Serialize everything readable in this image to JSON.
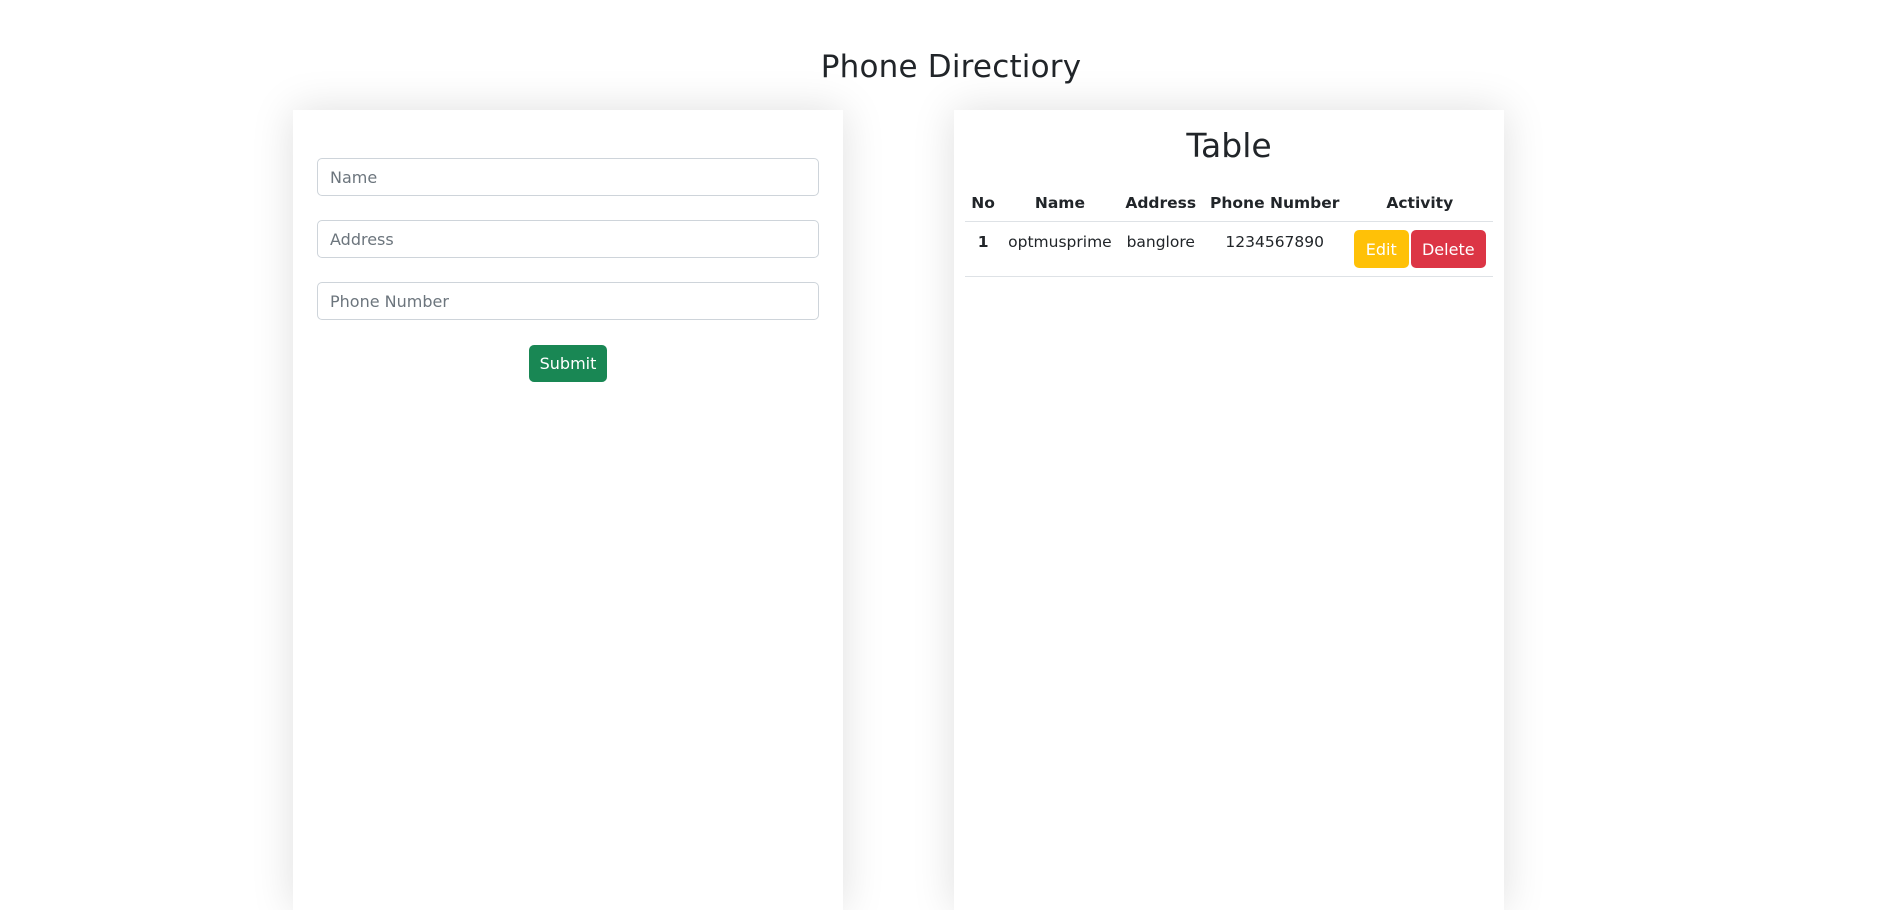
{
  "page": {
    "title": "Phone Directiory"
  },
  "form": {
    "name_placeholder": "Name",
    "address_placeholder": "Address",
    "phone_placeholder": "Phone Number",
    "name_value": "",
    "address_value": "",
    "phone_value": "",
    "submit_label": "Submit"
  },
  "table": {
    "title": "Table",
    "columns": [
      "No",
      "Name",
      "Address",
      "Phone Number",
      "Activity"
    ],
    "rows": [
      {
        "no": "1",
        "name": "optmusprime",
        "address": "banglore",
        "phone": "1234567890",
        "edit_label": "Edit",
        "delete_label": "Delete"
      }
    ]
  },
  "colors": {
    "submit": "#198754",
    "edit": "#ffc107",
    "delete": "#dc3545"
  }
}
